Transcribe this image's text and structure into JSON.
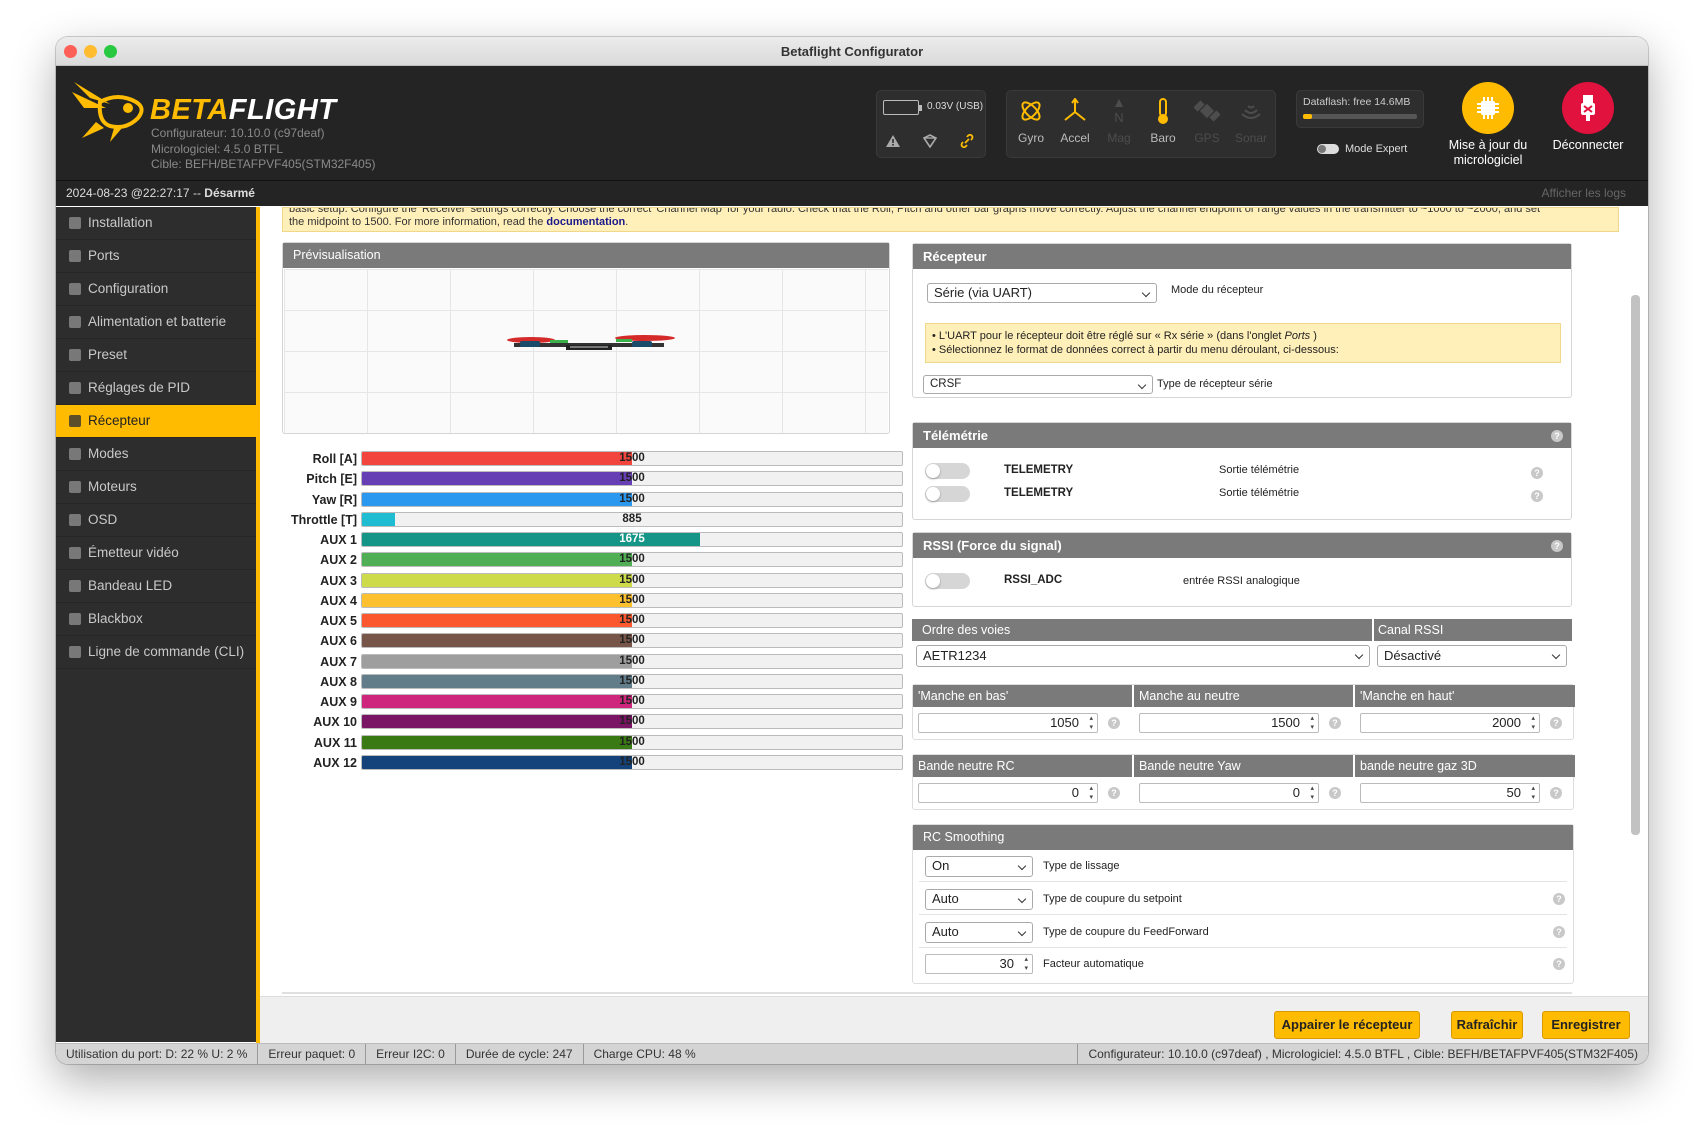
{
  "window": {
    "title": "Betaflight Configurator"
  },
  "header": {
    "brand": "BETAFLIGHT",
    "configurator": "Configurateur: 10.10.0 (c97deaf)",
    "firmware": "Micrologiciel: 4.5.0 BTFL",
    "target": "Cible: BEFH/BETAFPVF405(STM32F405)",
    "battery": "0.03V (USB)",
    "sensors": [
      {
        "name": "Gyro",
        "active": true,
        "icon": "gyro-icon"
      },
      {
        "name": "Accel",
        "active": true,
        "icon": "accel-icon"
      },
      {
        "name": "Mag",
        "active": false,
        "icon": "mag-icon"
      },
      {
        "name": "Baro",
        "active": true,
        "icon": "baro-icon"
      },
      {
        "name": "GPS",
        "active": false,
        "icon": "gps-icon"
      },
      {
        "name": "Sonar",
        "active": false,
        "icon": "sonar-icon"
      }
    ],
    "dataflash": "Dataflash: free 14.6MB",
    "expert_mode": "Mode Expert",
    "update_label": "Mise à jour du micrologiciel",
    "disconnect_label": "Déconnecter"
  },
  "status": {
    "datetime": "2024-08-23 @22:27:17 --",
    "state": "Désarmé",
    "show_logs": "Afficher les logs"
  },
  "sidebar": {
    "items": [
      {
        "label": "Installation",
        "icon": "wrench-icon"
      },
      {
        "label": "Ports",
        "icon": "plug-icon"
      },
      {
        "label": "Configuration",
        "icon": "gear-icon"
      },
      {
        "label": "Alimentation et batterie",
        "icon": "battery-icon"
      },
      {
        "label": "Preset",
        "icon": "preset-icon"
      },
      {
        "label": "Réglages de PID",
        "icon": "pid-icon"
      },
      {
        "label": "Récepteur",
        "icon": "receiver-icon",
        "active": true
      },
      {
        "label": "Modes",
        "icon": "modes-icon"
      },
      {
        "label": "Moteurs",
        "icon": "motor-icon"
      },
      {
        "label": "OSD",
        "icon": "osd-icon"
      },
      {
        "label": "Émetteur vidéo",
        "icon": "vtx-icon"
      },
      {
        "label": "Bandeau LED",
        "icon": "led-icon"
      },
      {
        "label": "Blackbox",
        "icon": "blackbox-icon"
      },
      {
        "label": "Ligne de commande (CLI)",
        "icon": "cli-icon"
      }
    ]
  },
  "note": {
    "line1": "basic setup. Configure the 'Receiver' settings correctly. Choose the correct 'Channel Map' for your radio. Check that the Roll, Pitch and other bar graphs move correctly. Adjust the channel endpoint or range values in the transmitter to ~1000 to ~2000, and set",
    "line2": "the midpoint to 1500. For more information, read the ",
    "link": "documentation",
    "end": "."
  },
  "preview": {
    "title": "Prévisualisation"
  },
  "channels": [
    {
      "label": "Roll [A]",
      "value": 1500,
      "color": "#f1453d"
    },
    {
      "label": "Pitch [E]",
      "value": 1500,
      "color": "#673fb4"
    },
    {
      "label": "Yaw [R]",
      "value": 1500,
      "color": "#2b98f0"
    },
    {
      "label": "Throttle [T]",
      "value": 885,
      "color": "#1fbcd2"
    },
    {
      "label": "AUX 1",
      "value": 1675,
      "color": "#159588"
    },
    {
      "label": "AUX 2",
      "value": 1500,
      "color": "#50ae55"
    },
    {
      "label": "AUX 3",
      "value": 1500,
      "color": "#cdda49"
    },
    {
      "label": "AUX 4",
      "value": 1500,
      "color": "#fdc02f"
    },
    {
      "label": "AUX 5",
      "value": 1500,
      "color": "#fc5830"
    },
    {
      "label": "AUX 6",
      "value": 1500,
      "color": "#785549"
    },
    {
      "label": "AUX 7",
      "value": 1500,
      "color": "#9e9e9e"
    },
    {
      "label": "AUX 8",
      "value": 1500,
      "color": "#617d8a"
    },
    {
      "label": "AUX 9",
      "value": 1500,
      "color": "#cf267d"
    },
    {
      "label": "AUX 10",
      "value": 1500,
      "color": "#7a1464"
    },
    {
      "label": "AUX 11",
      "value": 1500,
      "color": "#3a7a14"
    },
    {
      "label": "AUX 12",
      "value": 1500,
      "color": "#14427a"
    }
  ],
  "receiver": {
    "title": "Récepteur",
    "mode": "Série (via UART)",
    "mode_label": "Mode du récepteur",
    "info1": "• L'UART pour le récepteur doit être réglé sur « Rx série » (dans l'onglet ",
    "info1_em": "Ports",
    "info1_end": " )",
    "info2": "• Sélectionnez le format de données correct à partir du menu déroulant, ci-dessous:",
    "serial_type": "CRSF",
    "serial_label": "Type de récepteur série"
  },
  "telemetry": {
    "title": "Télémétrie",
    "rows": [
      {
        "name": "TELEMETRY",
        "desc": "Sortie télémétrie"
      },
      {
        "name": "TELEMETRY",
        "desc": "Sortie télémétrie"
      }
    ]
  },
  "rssi": {
    "title": "RSSI (Force du signal)",
    "name": "RSSI_ADC",
    "desc": "entrée RSSI analogique"
  },
  "channelmap": {
    "title": "Ordre des voies",
    "value": "AETR1234",
    "rssi_title": "Canal RSSI",
    "rssi_value": "Désactivé"
  },
  "sticks": {
    "low_title": "'Manche en bas'",
    "low": "1050",
    "center_title": "Manche au neutre",
    "center": "1500",
    "high_title": "'Manche en haut'",
    "high": "2000"
  },
  "deadband": {
    "rc_title": "Bande neutre RC",
    "rc": "0",
    "yaw_title": "Bande neutre Yaw",
    "yaw": "0",
    "gas_title": "bande neutre gaz 3D",
    "gas": "50"
  },
  "smoothing": {
    "title": "RC Smoothing",
    "rows": [
      {
        "value": "On",
        "label": "Type de lissage"
      },
      {
        "value": "Auto",
        "label": "Type de coupure du setpoint"
      },
      {
        "value": "Auto",
        "label": "Type de coupure du FeedForward"
      }
    ],
    "factor": "30",
    "factor_label": "Facteur automatique"
  },
  "buttons": {
    "bind": "Appairer le récepteur",
    "refresh": "Rafraîchir",
    "save": "Enregistrer"
  },
  "bottom": {
    "port": "Utilisation du port: D: 22 % U: 2 %",
    "packet": "Erreur paquet: 0",
    "i2c": "Erreur I2C: 0",
    "cycle": "Durée de cycle: 247",
    "cpu": "Charge CPU: 48 %",
    "version": "Configurateur: 10.10.0 (c97deaf) , Micrologiciel: 4.5.0 BTFL , Cible: BEFH/BETAFPVF405(STM32F405)"
  },
  "colors": {
    "accent": "#ffbb00",
    "dark": "#242424",
    "sidebar": "#2d2d2d",
    "disconnect": "#e2123f"
  }
}
